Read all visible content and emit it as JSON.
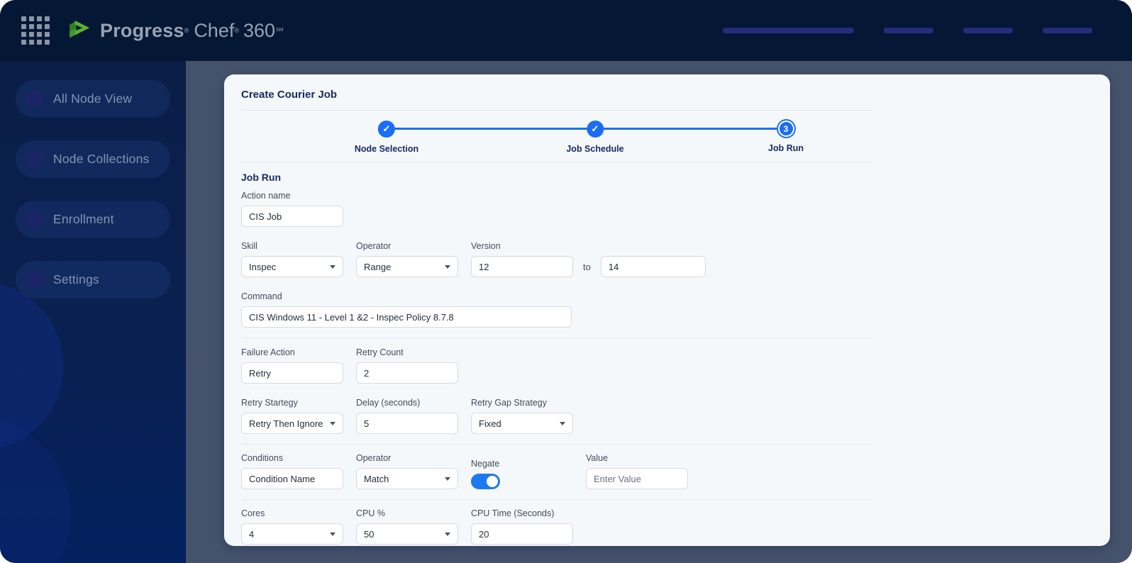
{
  "topbar": {
    "logo": {
      "progress": "Progress",
      "reg": "®",
      "chef": "Chef",
      "three_sixty": "360",
      "sm": "SM"
    }
  },
  "sidebar": {
    "items": [
      {
        "label": "All Node View"
      },
      {
        "label": "Node Collections"
      },
      {
        "label": "Enrollment"
      },
      {
        "label": "Settings"
      }
    ]
  },
  "card": {
    "title": "Create Courier Job",
    "stepper": {
      "steps": [
        {
          "label": "Node Selection",
          "status": "done"
        },
        {
          "label": "Job Schedule",
          "status": "done"
        },
        {
          "label": "Job Run",
          "status": "current",
          "number": "3"
        }
      ]
    },
    "section_title": "Job Run"
  },
  "form": {
    "action_name": {
      "label": "Action name",
      "value": "CIS Job"
    },
    "skill": {
      "label": "Skill",
      "value": "Inspec"
    },
    "operator": {
      "label": "Operator",
      "value": "Range"
    },
    "version": {
      "label": "Version",
      "from": "12",
      "to_label": "to",
      "to": "14"
    },
    "command": {
      "label": "Command",
      "value": "CIS Windows 11 - Level 1 &2 - Inspec Policy 8.7.8"
    },
    "failure_action": {
      "label": "Failure Action",
      "value": "Retry"
    },
    "retry_count": {
      "label": "Retry Count",
      "value": "2"
    },
    "retry_strategy": {
      "label": "Retry Startegy",
      "value": "Retry Then Ignore"
    },
    "delay": {
      "label": "Delay (seconds)",
      "value": "5"
    },
    "retry_gap": {
      "label": "Retry Gap Strategy",
      "value": "Fixed"
    },
    "conditions": {
      "label": "Conditions",
      "value": "Condition Name"
    },
    "cond_operator": {
      "label": "Operator",
      "value": "Match"
    },
    "negate": {
      "label": "Negate",
      "state": "on"
    },
    "value_field": {
      "label": "Value",
      "placeholder": "Enter Value"
    },
    "cores": {
      "label": "Cores",
      "value": "4"
    },
    "cpu_percent": {
      "label": "CPU %",
      "value": "50"
    },
    "cpu_time": {
      "label": "CPU Time (Seconds)",
      "value": "20"
    }
  },
  "colors": {
    "accent_blue": "#1b6ef3",
    "toggle_on": "#1d79f2",
    "topbar_bg": "#041734",
    "sidebar_bg": "#0a1e47",
    "main_bg": "#44526c",
    "card_bg": "#f5f8fb",
    "navy_text": "#16295e",
    "logo_green": "#5cb130",
    "nav_placeholder": "#272c7d"
  }
}
